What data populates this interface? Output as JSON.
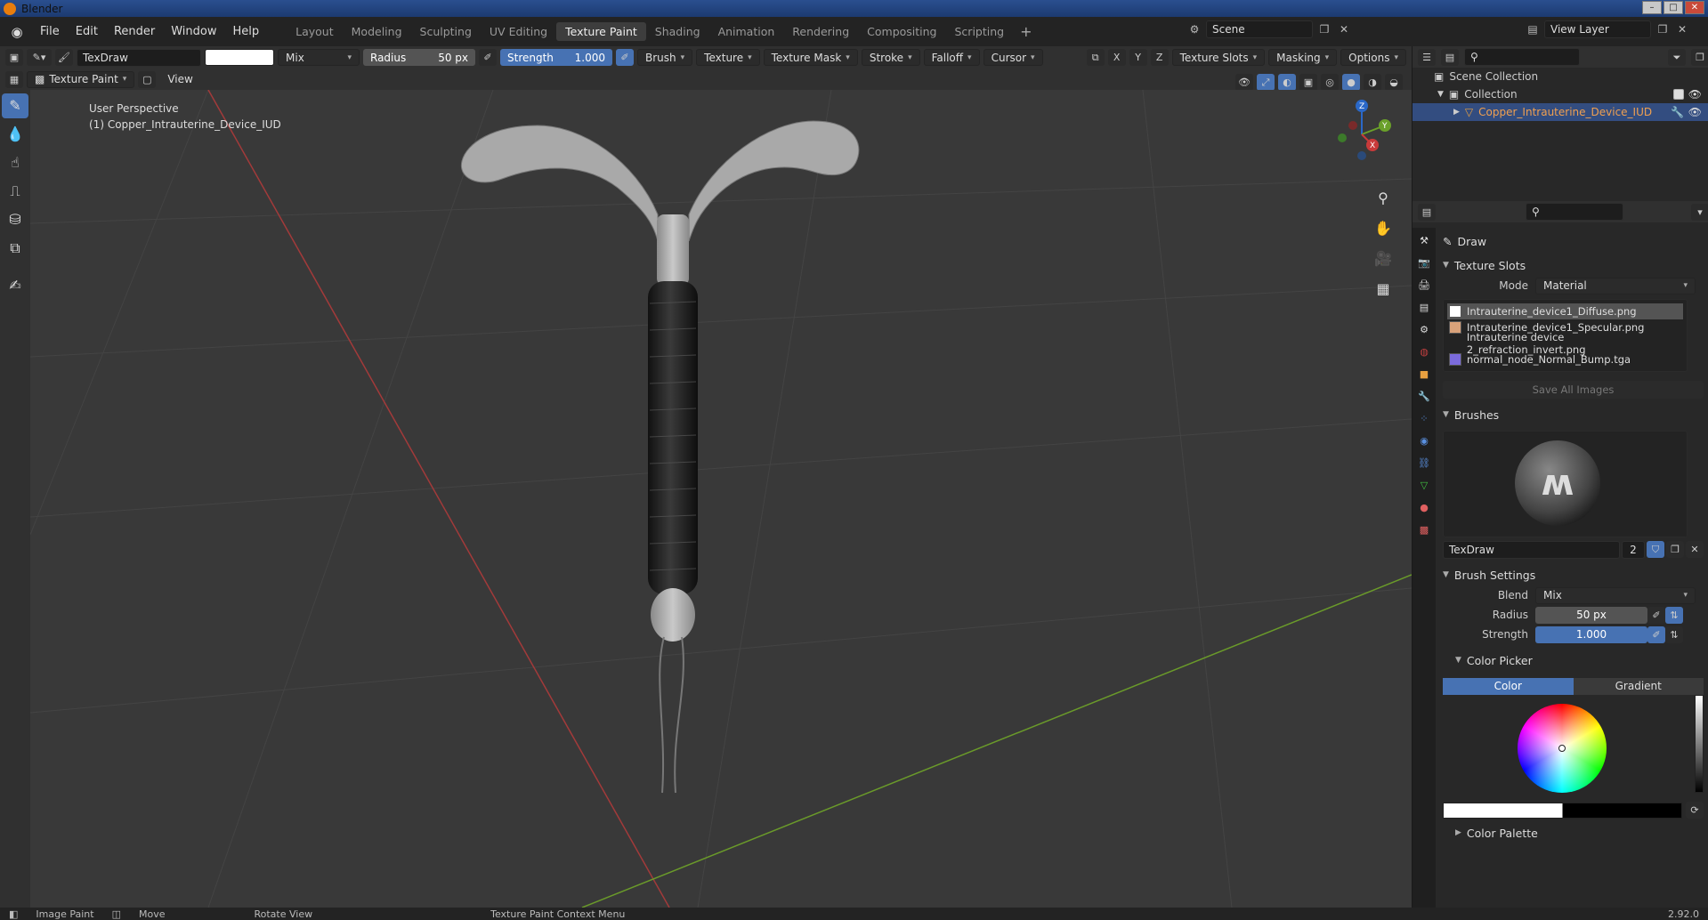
{
  "window": {
    "title": "Blender"
  },
  "menu": {
    "items": [
      "File",
      "Edit",
      "Render",
      "Window",
      "Help"
    ]
  },
  "workspaces": [
    "Layout",
    "Modeling",
    "Sculpting",
    "UV Editing",
    "Texture Paint",
    "Shading",
    "Animation",
    "Rendering",
    "Compositing",
    "Scripting"
  ],
  "active_workspace": "Texture Paint",
  "scene": {
    "name": "Scene"
  },
  "view_layer": {
    "name": "View Layer"
  },
  "tool_header": {
    "brush_name": "TexDraw",
    "blend": "Mix",
    "radius_label": "Radius",
    "radius_value": "50 px",
    "strength_label": "Strength",
    "strength_value": "1.000",
    "menus": [
      "Brush",
      "Texture",
      "Texture Mask",
      "Stroke",
      "Falloff",
      "Cursor"
    ],
    "axes": [
      "X",
      "Y",
      "Z"
    ],
    "right_menus": [
      "Texture Slots",
      "Masking",
      "Options"
    ]
  },
  "view_header": {
    "mode": "Texture Paint",
    "view": "View"
  },
  "viewport": {
    "perspective": "User Perspective",
    "object_label": "(1) Copper_Intrauterine_Device_IUD",
    "colors": {
      "x_axis": "#a23a3a",
      "y_axis": "#6a9a2a",
      "grid": "#444444",
      "bg": "#393939"
    }
  },
  "gizmo": {
    "x": "X",
    "y": "Y",
    "z": "Z"
  },
  "outliner": {
    "scene_collection": "Scene Collection",
    "collection": "Collection",
    "object": "Copper_Intrauterine_Device_IUD"
  },
  "properties": {
    "tool_name": "Draw",
    "texture_slots": {
      "header": "Texture Slots",
      "mode_label": "Mode",
      "mode_value": "Material",
      "items": [
        {
          "name": "Intrauterine_device1_Diffuse.png",
          "color": "#ffffff"
        },
        {
          "name": "Intrauterine_device1_Specular.png",
          "color": "#d9a27a"
        },
        {
          "name": "Intrauterine device 2_refraction_invert.png",
          "color": "#232323"
        },
        {
          "name": "normal_node_Normal_Bump.tga",
          "color": "#7b6bdc"
        }
      ],
      "save_all": "Save All Images"
    },
    "brushes": {
      "header": "Brushes",
      "name": "TexDraw",
      "users": "2"
    },
    "brush_settings": {
      "header": "Brush Settings",
      "blend_label": "Blend",
      "blend_value": "Mix",
      "radius_label": "Radius",
      "radius_value": "50 px",
      "strength_label": "Strength",
      "strength_value": "1.000"
    },
    "color_picker": {
      "header": "Color Picker",
      "tab_color": "Color",
      "tab_gradient": "Gradient"
    },
    "color_palette": {
      "header": "Color Palette"
    }
  },
  "statusbar": {
    "items": [
      "Image Paint",
      "Move",
      "Rotate View",
      "Texture Paint Context Menu"
    ],
    "version": "2.92.0"
  }
}
